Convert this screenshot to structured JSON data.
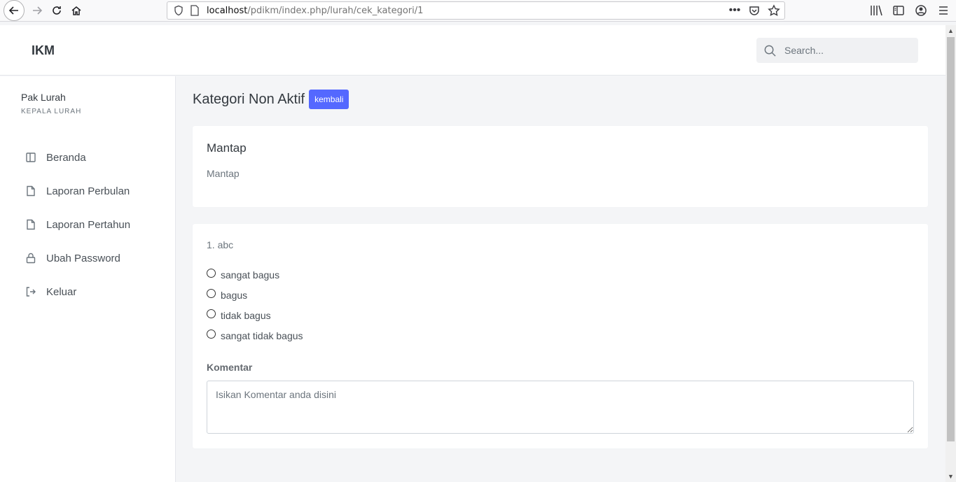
{
  "browser": {
    "url_host": "localhost",
    "url_path": "/pdikm/index.php/lurah/cek_kategori/1"
  },
  "header": {
    "brand": "IKM",
    "search_placeholder": "Search..."
  },
  "sidebar": {
    "user_name": "Pak Lurah",
    "user_role": "KEPALA LURAH",
    "items": [
      {
        "label": "Beranda",
        "icon": "layout-icon"
      },
      {
        "label": "Laporan Perbulan",
        "icon": "file-icon"
      },
      {
        "label": "Laporan Pertahun",
        "icon": "file-icon"
      },
      {
        "label": "Ubah Password",
        "icon": "lock-icon"
      },
      {
        "label": "Keluar",
        "icon": "logout-icon"
      }
    ]
  },
  "main": {
    "title": "Kategori Non Aktif",
    "back_label": "kembali",
    "category_card": {
      "title": "Mantap",
      "description": "Mantap"
    },
    "question_card": {
      "question": "1. abc",
      "options": [
        "sangat bagus",
        "bagus",
        "tidak bagus",
        "sangat tidak bagus"
      ],
      "comment_label": "Komentar",
      "comment_placeholder": "Isikan Komentar anda disini"
    }
  },
  "colors": {
    "accent": "#5468ff",
    "background": "#f4f5f7"
  }
}
